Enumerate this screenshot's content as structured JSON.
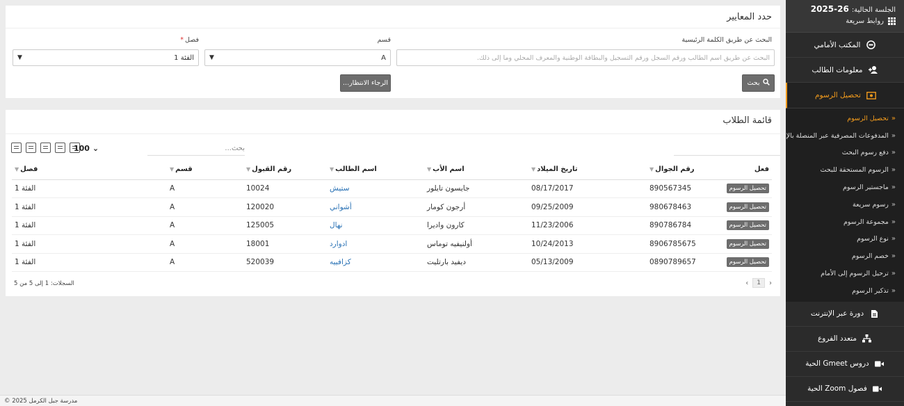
{
  "sidebar": {
    "session_label": "الجلسة الحالية:",
    "session_year": "2025-26",
    "quick_links": "روابط سريعة",
    "items": [
      {
        "label": "المكتب الأمامي",
        "icon": "front-office-icon"
      },
      {
        "label": "معلومات الطالب",
        "icon": "user-plus-icon"
      },
      {
        "label": "تحصيل الرسوم",
        "icon": "money-icon",
        "active": true
      }
    ],
    "submenu": [
      {
        "label": "تحصيل الرسوم",
        "active": true
      },
      {
        "label": "المدفوعات المصرفية عبر المنصلة بالإنتر"
      },
      {
        "label": "دفع رسوم البحث"
      },
      {
        "label": "الرسوم المستحقة للبحث"
      },
      {
        "label": "ماجستير الرسوم"
      },
      {
        "label": "رسوم سريعة"
      },
      {
        "label": "مجموعة الرسوم"
      },
      {
        "label": "نوع الرسوم"
      },
      {
        "label": "خصم الرسوم"
      },
      {
        "label": "ترحيل الرسوم إلى الأمام"
      },
      {
        "label": "تذكير الرسوم"
      }
    ],
    "bottom_items": [
      {
        "label": "دورة عبر الإنترنت",
        "icon": "course-icon"
      },
      {
        "label": "متعدد الفروع",
        "icon": "branches-icon"
      },
      {
        "label": "دروس Gmeet الحية",
        "icon": "video-icon"
      },
      {
        "label": "فصول Zoom الحية",
        "icon": "video-icon"
      }
    ]
  },
  "filter": {
    "title": "حدد المعايير",
    "class_label": "فصل",
    "class_value": "الفئة 1",
    "section_label": "قسم",
    "section_value": "A",
    "search_label": "البحث عن طريق الكلمة الرئيسية",
    "search_placeholder": "البحث عن طريق اسم الطالب ورقم السجل ورقم التسجيل والبطاقة الوطنية والمعرف المحلي وما إلى ذلك.",
    "wait_button": "الرجاء الانتظار...",
    "search_button": "بحث"
  },
  "list": {
    "title": "قائمة الطلاب",
    "page_size": "100",
    "search_placeholder": "بحث...",
    "columns": {
      "action": "فعل",
      "mobile": "رقم الجوال",
      "dob": "تاريخ الميلاد",
      "father": "اسم الأب",
      "student": "اسم الطالب",
      "admission": "رقم القبول",
      "section": "قسم",
      "class": "فصل"
    },
    "rows": [
      {
        "action": "تحصيل الرسوم",
        "mobile": "890567345",
        "dob": "08/17/2017",
        "father": "جايسون تايلور",
        "student": "ستيش",
        "admission": "10024",
        "section": "A",
        "class": "الفئة 1"
      },
      {
        "action": "تحصيل الرسوم",
        "mobile": "980678463",
        "dob": "09/25/2009",
        "father": "أرجون كومار",
        "student": "أشواني",
        "admission": "120020",
        "section": "A",
        "class": "الفئة 1"
      },
      {
        "action": "تحصيل الرسوم",
        "mobile": "890786784",
        "dob": "11/23/2006",
        "father": "كارون واديرا",
        "student": "نهال",
        "admission": "125005",
        "section": "A",
        "class": "الفئة 1"
      },
      {
        "action": "تحصيل الرسوم",
        "mobile": "8906785675",
        "dob": "10/24/2013",
        "father": "أولنيفيه توماس",
        "student": "ادوارد",
        "admission": "18001",
        "section": "A",
        "class": "الفئة 1"
      },
      {
        "action": "تحصيل الرسوم",
        "mobile": "0890789657",
        "dob": "05/13/2009",
        "father": "ديفيد بارتليت",
        "student": "كزافييه",
        "admission": "520039",
        "section": "A",
        "class": "الفئة 1"
      }
    ],
    "records_text": "السجلات: 1 إلى 5 من 5",
    "current_page": "1"
  },
  "footer": {
    "copyright": "© 2025 مدرسة جبل الكرمل"
  }
}
